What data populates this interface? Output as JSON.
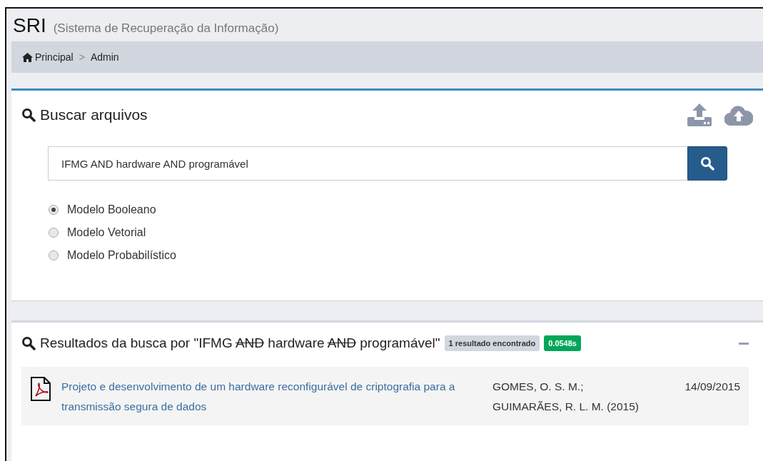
{
  "header": {
    "title": "SRI",
    "subtitle": "(Sistema de Recuperação da Informação)"
  },
  "breadcrumb": {
    "items": [
      "Principal",
      "Admin"
    ],
    "separator": ">"
  },
  "search_panel": {
    "title": "Buscar arquivos",
    "query": "IFMG AND hardware AND programável",
    "models": [
      {
        "label": "Modelo Booleano",
        "selected": true
      },
      {
        "label": "Modelo Vetorial",
        "selected": false
      },
      {
        "label": "Modelo Probabilístico",
        "selected": false
      }
    ]
  },
  "results_panel": {
    "title_parts": [
      {
        "text": "Resultados da busca por \"IFMG ",
        "struck": false
      },
      {
        "text": "AND",
        "struck": true
      },
      {
        "text": " hardware ",
        "struck": false
      },
      {
        "text": "AND",
        "struck": true
      },
      {
        "text": " programável\"",
        "struck": false
      }
    ],
    "count_badge": "1 resultado encontrado",
    "time_badge": "0.0548s",
    "results": [
      {
        "title": "Projeto e desenvolvimento de um hardware reconfigurável de criptografia para a transmissão segura de dados",
        "authors": [
          "GOMES, O. S. M.;",
          "GUIMARÃES, R. L. M. (2015)"
        ],
        "date": "14/09/2015"
      }
    ]
  }
}
